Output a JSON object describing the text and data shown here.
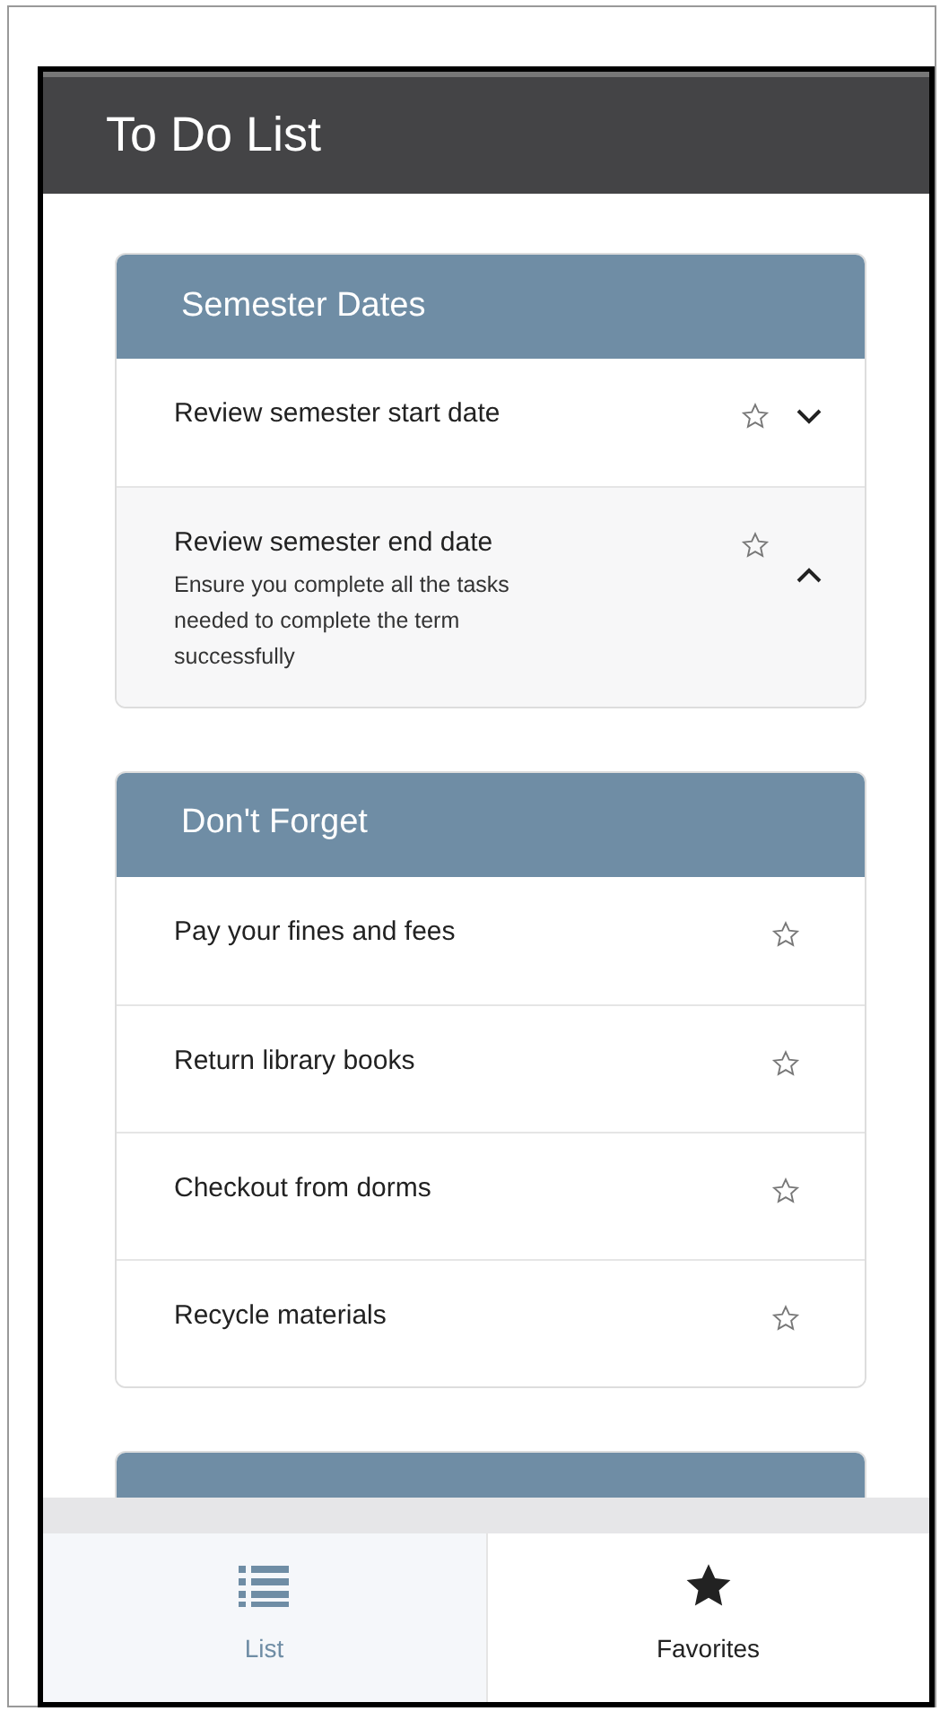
{
  "app_bar": {
    "title": "To Do List"
  },
  "sections": [
    {
      "title": "Semester Dates",
      "cut_off": false,
      "items": [
        {
          "title": "Review semester start date",
          "starred": false,
          "expanded": false
        },
        {
          "title": "Review semester end date",
          "detail": "Ensure you complete all the tasks needed to complete the term successfully",
          "starred": false,
          "expanded": true
        }
      ]
    },
    {
      "title": "Don't Forget",
      "cut_off": false,
      "items": [
        {
          "title": "Pay your fines and fees",
          "starred": false
        },
        {
          "title": "Return library books",
          "starred": false
        },
        {
          "title": "Checkout from dorms",
          "starred": false
        },
        {
          "title": "Recycle materials",
          "starred": false
        }
      ]
    },
    {
      "cut_off": true
    }
  ],
  "tabs": [
    {
      "label": "List",
      "kind": "list",
      "selected": true
    },
    {
      "label": "Favorites",
      "kind": "star",
      "selected": false
    }
  ]
}
